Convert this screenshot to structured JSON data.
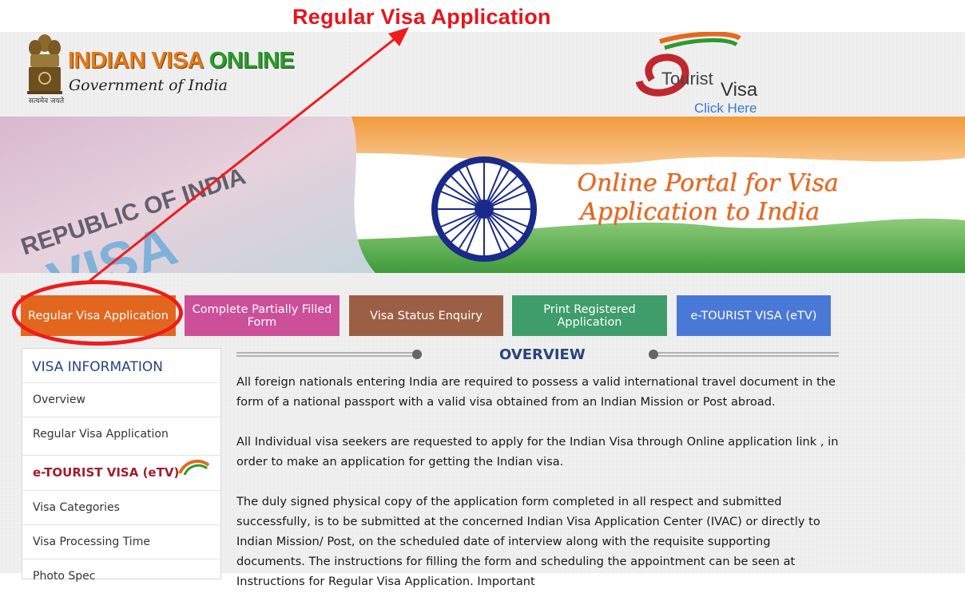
{
  "annotation": {
    "title": "Regular Visa Application",
    "color": "#e8141a"
  },
  "header": {
    "emblem_motto": "सत्यमेव जयते",
    "logo_part1": "INDIAN VISA ",
    "logo_part2": "ONLINE",
    "logo_subtitle": "Government of India",
    "etourist_word1": "Tourist",
    "etourist_word2": "Visa",
    "etourist_click": "Click Here"
  },
  "banner": {
    "visa_stamp_text1": "REPUBLIC OF INDIA",
    "visa_stamp_text2": "VISA",
    "line1": "Online Portal for Visa",
    "line2": "Application to India"
  },
  "nav": {
    "regular": "Regular Visa Application",
    "complete": "Complete Partially Filled Form",
    "status": "Visa Status Enquiry",
    "print": "Print Registered Application",
    "etv": "e-TOURIST VISA (eTV)"
  },
  "sidebar": {
    "title": "VISA INFORMATION",
    "items": [
      "Overview",
      "Regular Visa Application",
      "e-TOURIST VISA (eTV)",
      "Visa Categories",
      "Visa Processing Time",
      "Photo Spec"
    ]
  },
  "overview": {
    "title": "OVERVIEW",
    "p1": "All foreign nationals entering India are required to possess a valid international travel document in the form of a national passport with a valid visa obtained from an Indian Mission or Post abroad.",
    "p2": "All Individual visa seekers are requested to apply for the Indian Visa through Online application link , in order to make an application for getting the Indian visa.",
    "p3": "The duly signed physical copy of the application form completed in all respect and submitted successfully, is to be submitted at the concerned Indian Visa Application Center (IVAC) or directly to Indian Mission/ Post, on the scheduled date of interview along with the requisite supporting documents. The instructions for filling the form and scheduling the appointment can be seen at Instructions for Regular Visa Application. Important"
  },
  "colors": {
    "saffron": "#e2661e",
    "pink": "#cc4f9a",
    "brown": "#9b5f45",
    "green": "#3e9d6b",
    "blue": "#4a78d6",
    "navy": "#27457a"
  }
}
